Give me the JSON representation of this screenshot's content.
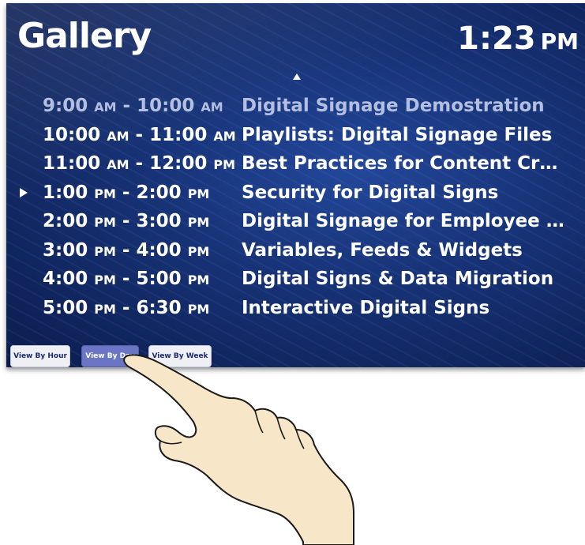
{
  "header": {
    "title": "Gallery",
    "clock_time": "1:23",
    "clock_ampm": "PM"
  },
  "schedule": [
    {
      "start": "9:00",
      "start_ap": "AM",
      "sep": " - ",
      "end": "10:00",
      "end_ap": "AM",
      "title": "Digital Signage Demostration",
      "status": "past"
    },
    {
      "start": "10:00",
      "start_ap": "AM",
      "sep": " - ",
      "end": "11:00",
      "end_ap": "AM",
      "title": "Playlists: Digital Signage Files",
      "status": "upcoming"
    },
    {
      "start": "11:00",
      "start_ap": "AM",
      "sep": " - ",
      "end": "12:00",
      "end_ap": "PM",
      "title": "Best Practices for Content Creat...",
      "status": "upcoming"
    },
    {
      "start": "1:00",
      "start_ap": "PM",
      "sep": " - ",
      "end": "2:00",
      "end_ap": "PM",
      "title": "Security for Digital Signs",
      "status": "current"
    },
    {
      "start": "2:00",
      "start_ap": "PM",
      "sep": " - ",
      "end": "3:00",
      "end_ap": "PM",
      "title": "Digital Signage for Employee Co...",
      "status": "upcoming"
    },
    {
      "start": "3:00",
      "start_ap": "PM",
      "sep": " - ",
      "end": "4:00",
      "end_ap": "PM",
      "title": "Variables, Feeds & Widgets",
      "status": "upcoming"
    },
    {
      "start": "4:00",
      "start_ap": "PM",
      "sep": " - ",
      "end": "5:00",
      "end_ap": "PM",
      "title": "Digital Signs & Data Migration",
      "status": "upcoming"
    },
    {
      "start": "5:00",
      "start_ap": "PM",
      "sep": " - ",
      "end": "6:30",
      "end_ap": "PM",
      "title": "Interactive Digital Signs",
      "status": "upcoming"
    }
  ],
  "view_buttons": {
    "hour_label": "View By Hour",
    "day_label": "View By Day",
    "week_label": "View By Week",
    "selected": "View By Day"
  },
  "icons": {
    "scroll_up": "triangle-up-icon",
    "current_pointer": "triangle-right-icon",
    "hand": "pointing-hand-icon"
  },
  "colors": {
    "background": "#163173",
    "past_text": "#b3bfe0",
    "text": "#ffffff",
    "active_button": "#6a76c4"
  }
}
